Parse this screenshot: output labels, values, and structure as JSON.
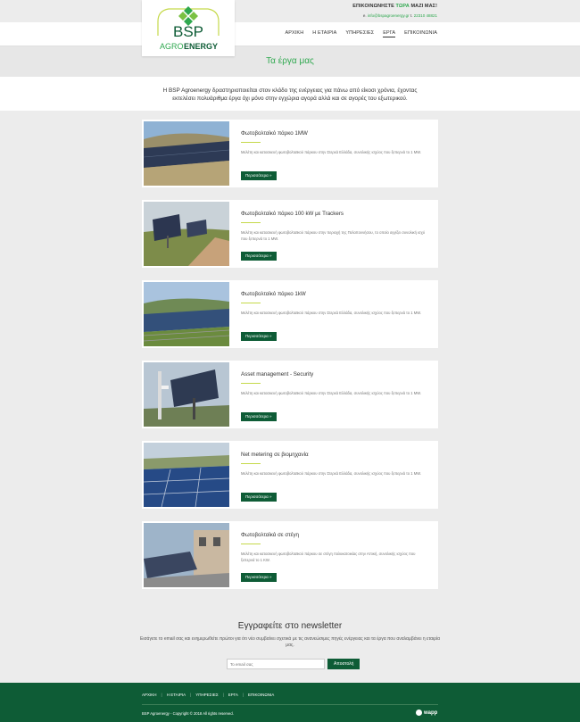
{
  "header": {
    "contact_prefix": "ΕΠΙΚΟΙΝΩΝΗΣΤΕ ",
    "contact_highlight": "ΤΩΡΑ",
    "contact_suffix": " ΜΑΖΙ ΜΑΣ!",
    "email_label": "e.",
    "email": "info@bspagroenergy.gr",
    "phone_label": "t.",
    "phone": "22310 48821",
    "logo_text_top": "BSP",
    "logo_text_agro": "AGRO",
    "logo_text_energy": "ENERGY"
  },
  "nav": [
    {
      "label": "ΑΡΧΙΚΗ",
      "active": false
    },
    {
      "label": "Η ΕΤΑΙΡΙΑ",
      "active": false
    },
    {
      "label": "ΥΠΗΡΕΣΙΕΣ",
      "active": false
    },
    {
      "label": "ΕΡΓΑ",
      "active": true
    },
    {
      "label": "ΕΠΙΚΟΙΝΩΝΙΑ",
      "active": false
    }
  ],
  "page": {
    "title": "Τα έργα μας",
    "intro": "Η BSP Agroenergy δραστηριοποιείται στον κλάδο της ενέργειας για πάνω από είκοσι χρόνια, έχοντας εκτελέσει πολυάριθμα έργα όχι μόνο στην εγχώρια αγορά αλλά και σε αγορές του εξωτερικού."
  },
  "projects": [
    {
      "title": "Φωτοβολταϊκό πάρκο 1MW",
      "desc": "Μελέτη και κατασκευή φωτοβολταϊκού πάρκου στην Στερεά Ελλάδα, συνολικής ισχύος που ξεπερνά το 1 MW.",
      "button": "Περισσότερα »"
    },
    {
      "title": "Φωτοβολταϊκό πάρκο 100 kW με Trackers",
      "desc": "Μελέτη και κατασκευή φωτοβολταϊκού πάρκου στην περιοχή της Πελοποννήσου, το οποίο αγγίζει συνολική ισχύ που ξεπερνά το 1 MW.",
      "button": "Περισσότερα »"
    },
    {
      "title": "Φωτοβολταϊκό πάρκο 1kW",
      "desc": "Μελέτη και κατασκευή φωτοβολταϊκού πάρκου στην Στερεά Ελλάδα, συνολικής ισχύος που ξεπερνά το 1 MW.",
      "button": "Περισσότερα »"
    },
    {
      "title": "Asset management - Security",
      "desc": "Μελέτη και κατασκευή φωτοβολταϊκού πάρκου στην Στερεά Ελλάδα, συνολικής ισχύος που ξεπερνά το 1 MW.",
      "button": "Περισσότερα »"
    },
    {
      "title": "Net metering σε βιομηχανία",
      "desc": "Μελέτη και κατασκευή φωτοβολταϊκού πάρκου στην Στερεά Ελλάδα, συνολικής ισχύος που ξεπερνά το 1 MW.",
      "button": "Περισσότερα »"
    },
    {
      "title": "Φωτοβολταϊκά σε στέγη",
      "desc": "Μελέτη και κατασκευή φωτοβολταϊκού πάρκου σε στέγη πολυκατοικίας στην Αττική, συνολικής ισχύος που ξεπερνά το 1 KW.",
      "button": "Περισσότερα »"
    }
  ],
  "newsletter": {
    "title": "Εγγραφείτε στο newsletter",
    "text": "Εισάγετε το email σας και ενημερωθείτε πρώτοι για ότι νέο συμβαίνει σχετικά με τις ανανεώσιμες πηγές ενέργειας και τα έργα που αναλαμβάνει η εταιρία μας.",
    "placeholder": "Το email σας",
    "button": "Αποστολή"
  },
  "footer": {
    "nav": [
      "ΑΡΧΙΚΗ",
      "Η ΕΤΑΙΡΙΑ",
      "ΥΠΗΡΕΣΙΕΣ",
      "ΕΡΓΑ",
      "ΕΠΙΚΟΙΝΩΝΙΑ"
    ],
    "copyright": "BSP Agroenergy - Copyright © 2018 All rights reserved.",
    "credit": "wapp"
  },
  "colors": {
    "brand_green": "#0e5c36",
    "accent_green": "#2fa84f",
    "accent_line": "#c5d94a"
  },
  "icons": {
    "logo": "bsp-leaf-logo",
    "credit": "wapp-logo"
  }
}
